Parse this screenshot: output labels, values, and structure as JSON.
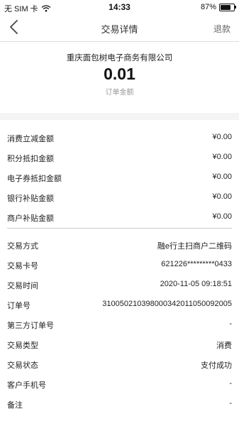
{
  "status_bar": {
    "carrier": "无 SIM 卡",
    "time": "14:33",
    "battery": "87%",
    "battery_level": 0.87
  },
  "header": {
    "title": "交易详情",
    "refund_label": "退款"
  },
  "summary": {
    "merchant": "重庆面包树电子商务有限公司",
    "amount": "0.01",
    "amount_label": "订单金额"
  },
  "discounts": [
    {
      "label": "消费立减金额",
      "value": "¥0.00"
    },
    {
      "label": "积分抵扣金额",
      "value": "¥0.00"
    },
    {
      "label": "电子券抵扣金额",
      "value": "¥0.00"
    },
    {
      "label": "银行补贴金额",
      "value": "¥0.00"
    },
    {
      "label": "商户补贴金额",
      "value": "¥0.00"
    }
  ],
  "details": [
    {
      "label": "交易方式",
      "value": "融e行主扫商户二维码"
    },
    {
      "label": "交易卡号",
      "value": "621226*********0433"
    },
    {
      "label": "交易时间",
      "value": "2020-11-05 09:18:51"
    },
    {
      "label": "订单号",
      "value": "310050210398000342011050092005"
    },
    {
      "label": "第三方订单号",
      "value": "-"
    },
    {
      "label": "交易类型",
      "value": "消费"
    },
    {
      "label": "交易状态",
      "value": "支付成功"
    },
    {
      "label": "客户手机号",
      "value": "-"
    },
    {
      "label": "备注",
      "value": "-"
    }
  ]
}
